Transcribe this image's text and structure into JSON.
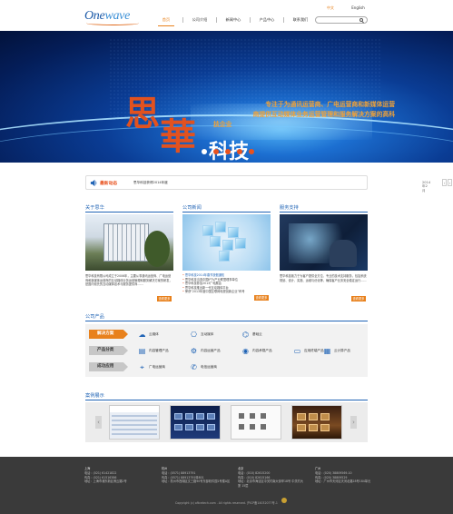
{
  "header": {
    "logo_text_a": "One",
    "logo_text_b": "wave",
    "lang_cn": "中文",
    "lang_en": "English",
    "nav": [
      {
        "label": "首页",
        "active": true
      },
      {
        "label": "公司介绍",
        "active": false
      },
      {
        "label": "新闻中心",
        "active": false
      },
      {
        "label": "产品中心",
        "active": false
      },
      {
        "label": "联系我们",
        "active": false
      }
    ],
    "search_placeholder": ""
  },
  "banner": {
    "char_si": "思",
    "char_hua": "華",
    "keji": "科技",
    "slogan_line1": "专注于为通讯运营商、广电运营商和新媒体运营",
    "slogan_line2": "商提供互动媒体业务运营管理和服务解决方案的高科",
    "slogan_line3": "技企业",
    "pager_count": 5,
    "pager_active": 0
  },
  "ticker": {
    "label": "最新动态",
    "text": "思华科技获得2014年度",
    "date": "2014年2月",
    "prev": "‹",
    "next": "›"
  },
  "about": {
    "title": "关于思华",
    "text": "思华科技有限公司成立于2006年，主要从事通讯运营商、广电运营商和新媒体运营商的互动媒体业务运营管理和服务解决方案的研发，是国内领先的互动媒体技术与服务提供商……",
    "more": "查看更多"
  },
  "news": {
    "title": "公司新闻",
    "items": [
      {
        "text": "思华科技2014年春节放假通知",
        "highlight": true
      },
      {
        "text": "思华科技当选中国IPTV产业联盟理事单位",
        "highlight": false
      },
      {
        "text": "思华科技参加2013广电展会",
        "highlight": false
      },
      {
        "text": "思华科技推出新一代互动媒体平台",
        "highlight": false
      },
      {
        "text": "荣获“2013年度中国互联网电视创新企业”称号",
        "highlight": false
      }
    ],
    "more": "查看更多"
  },
  "service": {
    "title": "服务支持",
    "text": "思华科技致力于为客户提供全方位、专业的技术支持服务，包括系统规划、设计、实施、运维与优化等，确保客户业务安全稳定运行……",
    "more": "查看更多"
  },
  "products": {
    "title": "公司产品",
    "rows": [
      {
        "tag": "解决方案",
        "style": "orange",
        "items": [
          {
            "icon": "cloud-icon",
            "glyph": "☁",
            "label": "云媒体"
          },
          {
            "icon": "interactive-media-icon",
            "glyph": "⎔",
            "label": "互动媒体"
          },
          {
            "icon": "base-station-icon",
            "glyph": "⌬",
            "label": "基础云"
          }
        ]
      },
      {
        "tag": "产品分类",
        "style": "gray",
        "items": [
          {
            "icon": "document-icon",
            "glyph": "▤",
            "label": "内容管理产品"
          },
          {
            "icon": "operations-icon",
            "glyph": "⚙",
            "label": "内容运营产品"
          },
          {
            "icon": "aggregation-icon",
            "glyph": "◉",
            "label": "内容承载产品"
          },
          {
            "icon": "terminal-icon",
            "glyph": "▭",
            "label": "应用终端产品"
          },
          {
            "icon": "cloud-compute-icon",
            "glyph": "▦",
            "label": "云计算产品"
          }
        ]
      },
      {
        "tag": "成功应用",
        "style": "gray",
        "items": [
          {
            "icon": "satellite-icon",
            "glyph": "⌖",
            "label": "广电运营商"
          },
          {
            "icon": "telecom-icon",
            "glyph": "✆",
            "label": "电信运营商"
          }
        ]
      }
    ]
  },
  "cases": {
    "title": "案例展示",
    "prev": "‹",
    "next": "›"
  },
  "footer": {
    "offices": [
      {
        "city": "上海",
        "lines": [
          "电话：(021) 61421822",
          "传真：(021) 61516386",
          "地址：上海市浦东新区博云路2号"
        ]
      },
      {
        "city": "杭州",
        "lines": [
          "电话：(0571) 88913791",
          "传真：(0571) 88913791转801",
          "地址：杭州市西湖区文三路90号东部软件园1号楼A区"
        ]
      },
      {
        "city": "北京",
        "lines": [
          "电话：(010) 82615200",
          "传真：(010) 82615166",
          "地址：北京市海淀区中关村南大街甲18号 中关村大厦 15层"
        ]
      },
      {
        "city": "广州",
        "lines": [
          "电话：(020) 38809569-10",
          "传真：(020) 38809529",
          "地址：广州市天河区天河北路28号184单元"
        ]
      }
    ],
    "copyright": "Copyright (c) oftcetech.com . All rights reserved. 沪ICP备14032077号-1"
  },
  "colors": {
    "accent_orange": "#e8811c",
    "brand_blue": "#1f63b5",
    "banner_red": "#e2521f",
    "footer_bg": "#3a3a3a"
  }
}
